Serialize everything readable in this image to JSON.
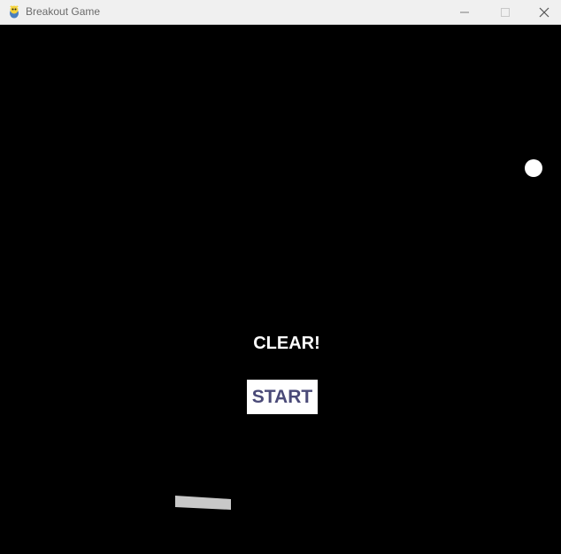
{
  "window": {
    "title": "Breakout Game",
    "app_icon": "pygame-snake-icon",
    "controls": {
      "minimize_icon": "minimize-icon",
      "maximize_icon": "maximize-icon",
      "close_icon": "close-icon"
    }
  },
  "game": {
    "status_text": "CLEAR!",
    "start_label": "START",
    "colors": {
      "background": "#000000",
      "ball": "#ffffff",
      "paddle": "#c8c8c8",
      "start_text": "#4a4a78"
    }
  }
}
